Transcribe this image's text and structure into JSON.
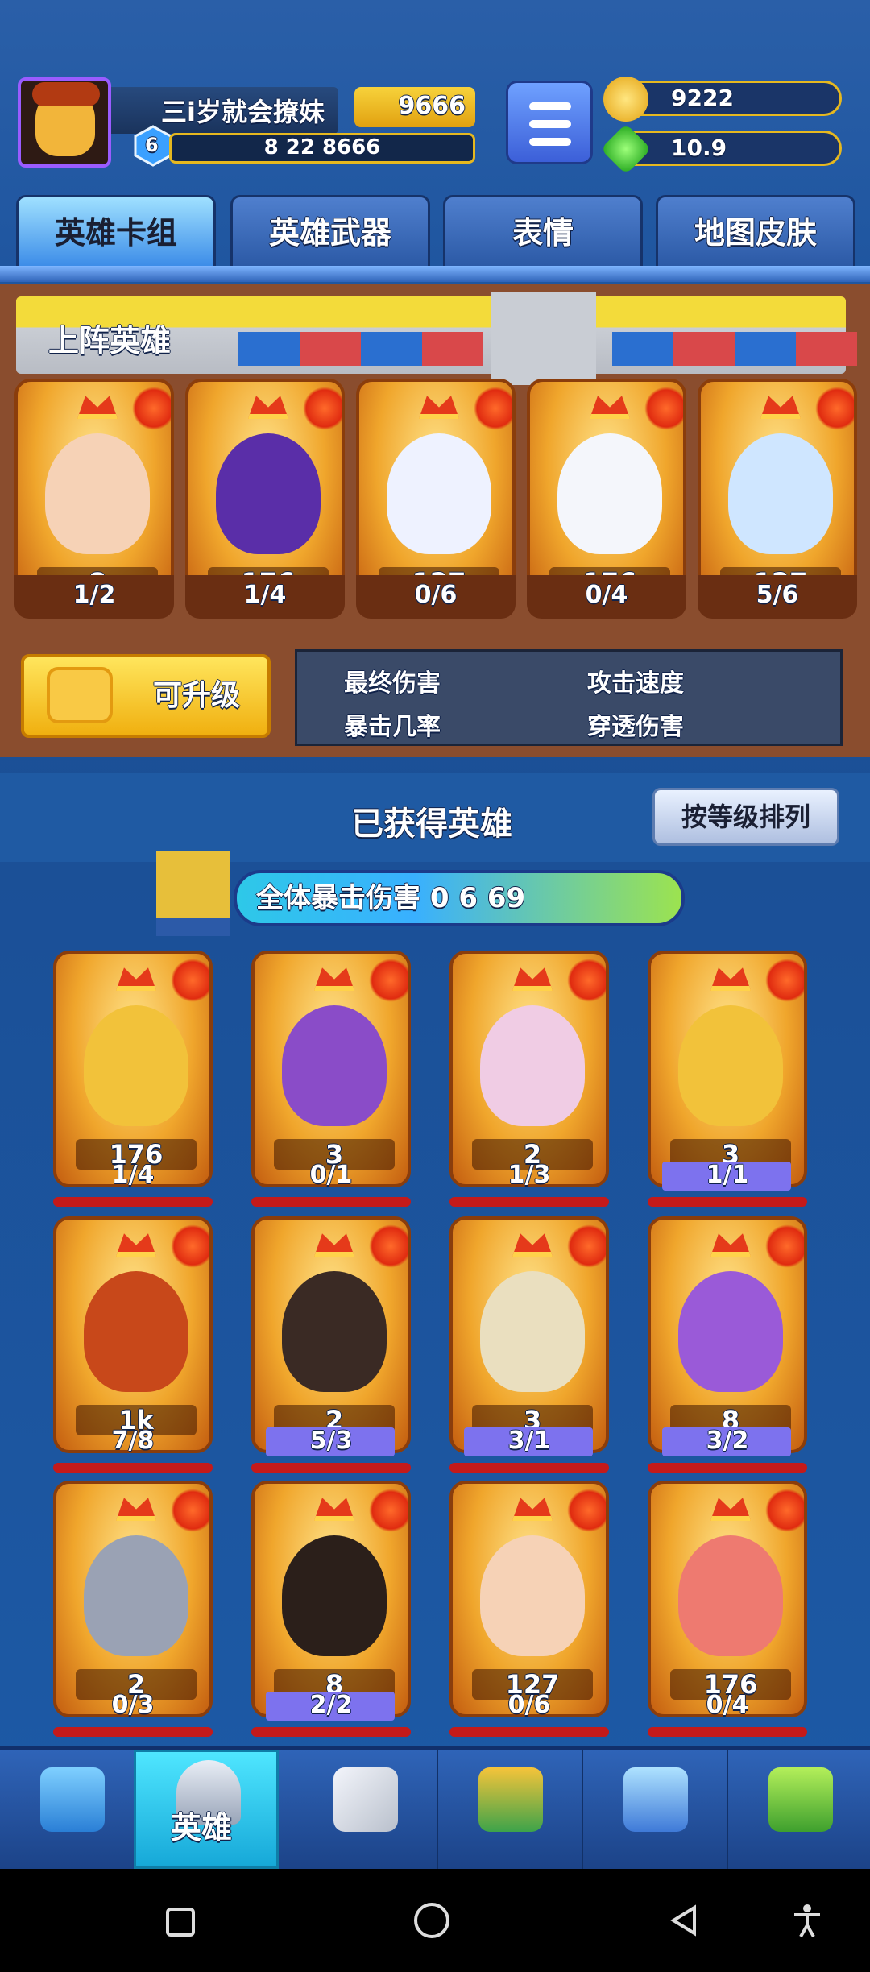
{
  "player": {
    "name": "三i岁就会撩妹",
    "level": "6",
    "power": "9666",
    "xp_text": "8 22 8666"
  },
  "resources": {
    "gold": "9222",
    "gems": "10.9"
  },
  "tabs": [
    "英雄卡组",
    "英雄武器",
    "表情",
    "地图皮肤"
  ],
  "lineup": {
    "title": "上阵英雄",
    "heroes": [
      {
        "level": "8",
        "count": "1/2"
      },
      {
        "level": "176",
        "count": "1/4"
      },
      {
        "level": "127",
        "count": "0/6"
      },
      {
        "level": "176",
        "count": "0/4"
      },
      {
        "level": "127",
        "count": "5/6"
      }
    ]
  },
  "upgrade_label": "可升级",
  "stats": {
    "final_damage": "最终伤害",
    "crit_rate": "暴击几率",
    "attack_speed": "攻击速度",
    "pierce_damage": "穿透伤害"
  },
  "obtained": {
    "title": "已获得英雄",
    "sort_label": "按等级排列",
    "bonus_label": "全体暴击伤害",
    "bonus_value": "0 6 69",
    "heroes": [
      {
        "level": "176",
        "count": "1/4",
        "full": false
      },
      {
        "level": "3",
        "count": "0/1",
        "full": false
      },
      {
        "level": "2",
        "count": "1/3",
        "full": false
      },
      {
        "level": "3",
        "count": "1/1",
        "full": true
      },
      {
        "level": "1k",
        "count": "7/8",
        "full": false
      },
      {
        "level": "2",
        "count": "5/3",
        "full": true
      },
      {
        "level": "3",
        "count": "3/1",
        "full": true
      },
      {
        "level": "8",
        "count": "3/2",
        "full": true
      },
      {
        "level": "2",
        "count": "0/3",
        "full": false
      },
      {
        "level": "8",
        "count": "2/2",
        "full": true
      },
      {
        "level": "127",
        "count": "0/6",
        "full": false
      },
      {
        "level": "176",
        "count": "0/4",
        "full": false
      }
    ]
  },
  "nav": {
    "hero_label": "英雄",
    "items": [
      "chest-icon",
      "helmet-icon",
      "swords-icon",
      "crown-shield-icon",
      "friends-icon",
      "sprout-icon"
    ]
  },
  "colors": {
    "accent_gold": "#f3db3a",
    "panel_brown": "#8a4d2e",
    "nav_active": "#2fc8ef"
  }
}
